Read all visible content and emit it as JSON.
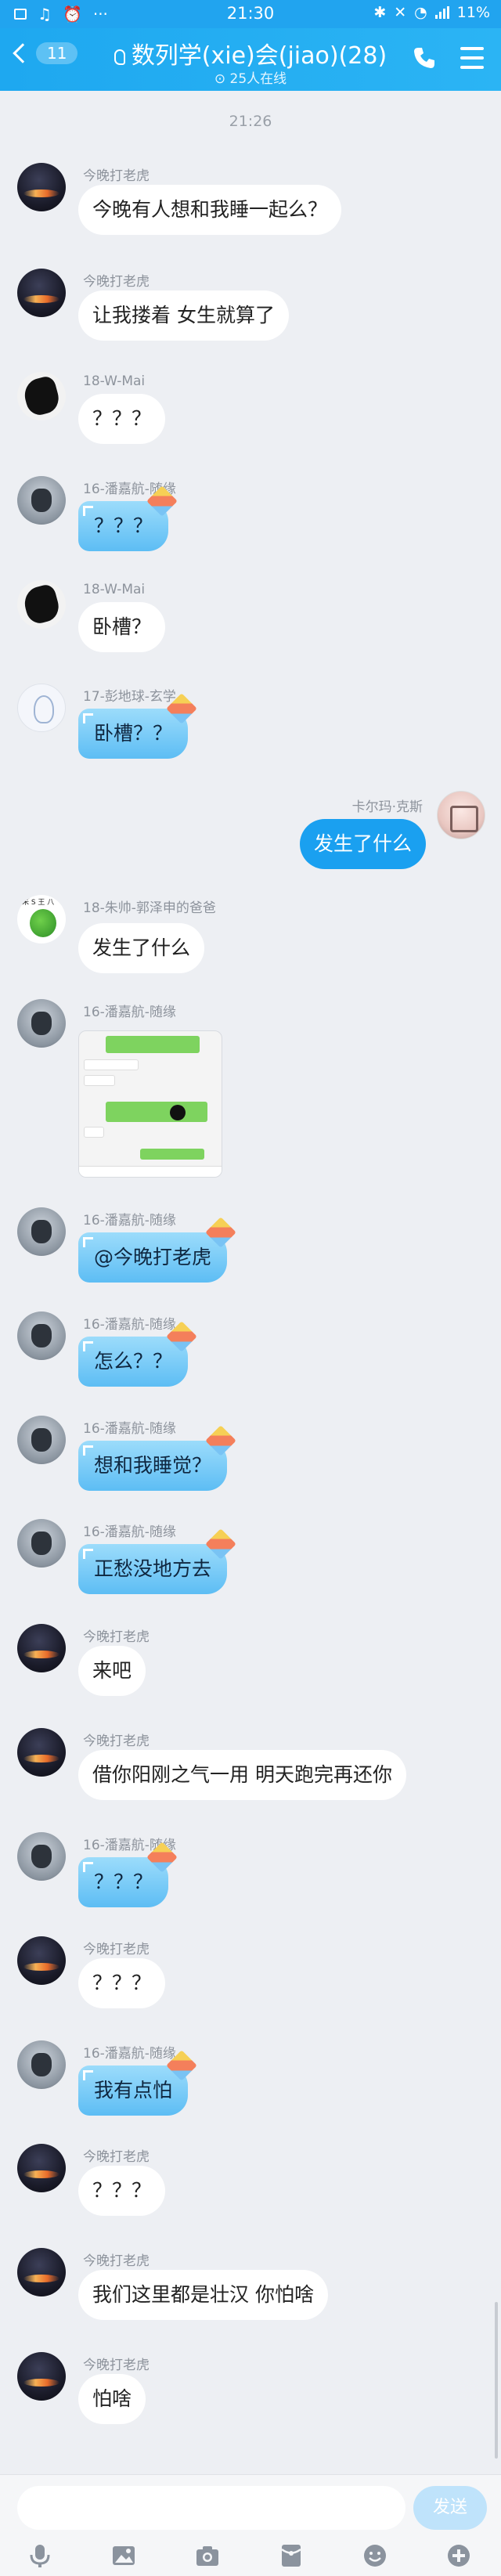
{
  "status_bar": {
    "time": "21:30",
    "battery": "11%",
    "more": "···"
  },
  "header": {
    "badge": "11",
    "title": "数列学(xie)会(jiao)(28)",
    "online": "25人在线"
  },
  "time_label": "21:26",
  "messages": [
    {
      "sender": "今晚打老虎",
      "text": "今晚有人想和我睡一起么？"
    },
    {
      "sender": "今晚打老虎",
      "text": "让我搂着 女生就算了"
    },
    {
      "sender": "18-W-Mai",
      "text": "？？？"
    },
    {
      "sender": "16-潘嘉航-随缘",
      "text": "？？？"
    },
    {
      "sender": "18-W-Mai",
      "text": "卧槽？"
    },
    {
      "sender": "17-彭地球-玄学",
      "text": "卧槽？？"
    },
    {
      "sender": "卡尔玛·克斯",
      "text": "发生了什么"
    },
    {
      "sender": "18-朱帅-郭泽申的爸爸",
      "text": "发生了什么"
    },
    {
      "sender": "16-潘嘉航-随缘",
      "text": ""
    },
    {
      "sender": "16-潘嘉航-随缘",
      "text": "@今晚打老虎"
    },
    {
      "sender": "16-潘嘉航-随缘",
      "text": "怎么？？"
    },
    {
      "sender": "16-潘嘉航-随缘",
      "text": "想和我睡觉？"
    },
    {
      "sender": "16-潘嘉航-随缘",
      "text": "正愁没地方去"
    },
    {
      "sender": "今晚打老虎",
      "text": "来吧"
    },
    {
      "sender": "今晚打老虎",
      "text": "借你阳刚之气一用 明天跑完再还你"
    },
    {
      "sender": "16-潘嘉航-随缘",
      "text": "？？？"
    },
    {
      "sender": "今晚打老虎",
      "text": "？？？"
    },
    {
      "sender": "16-潘嘉航-随缘",
      "text": "我有点怕"
    },
    {
      "sender": "今晚打老虎",
      "text": "？？？"
    },
    {
      "sender": "今晚打老虎",
      "text": "我们这里都是壮汉 你怕啥"
    },
    {
      "sender": "今晚打老虎",
      "text": "怕啥"
    }
  ],
  "zhu_avatar_text": "朱 S 王 八",
  "input": {
    "placeholder": "",
    "send": "发送"
  },
  "icons": [
    "mic-icon",
    "image-icon",
    "camera-icon",
    "red-packet-icon",
    "emoji-icon",
    "plus-icon"
  ],
  "colors": {
    "accent": "#21a4ef",
    "self_bubble": "#1aa0f0",
    "background": "#edeff3"
  }
}
